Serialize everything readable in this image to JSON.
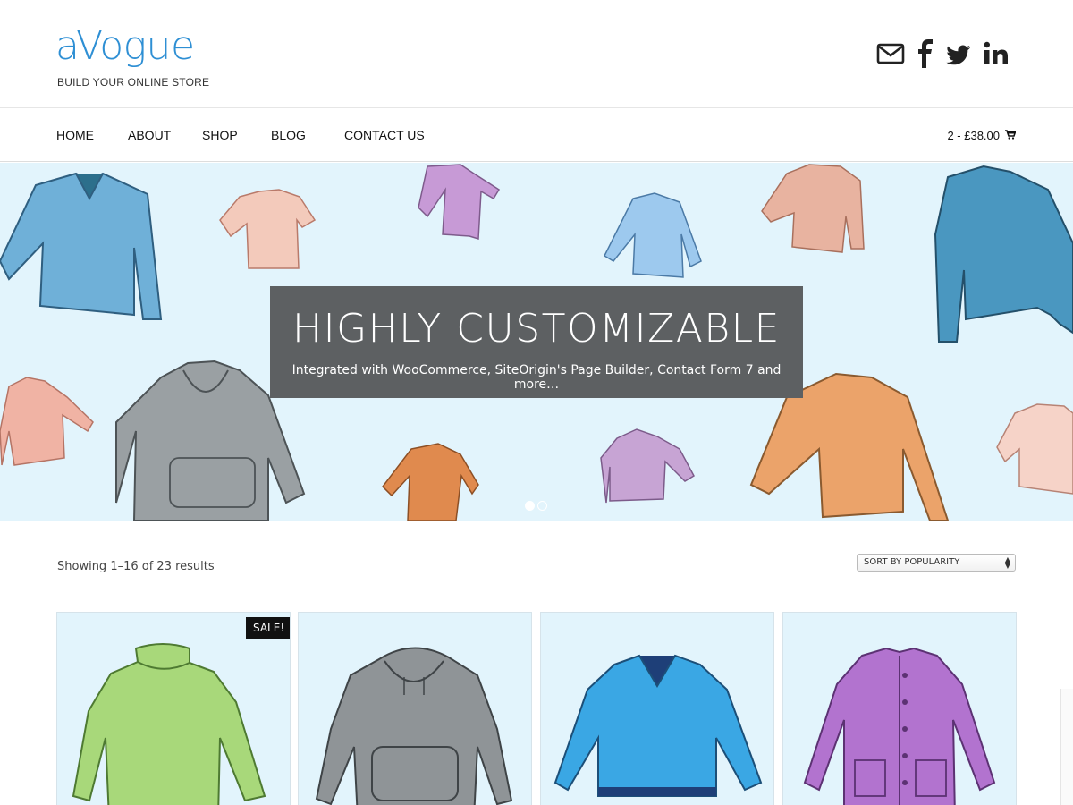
{
  "site": {
    "logo": "aVogue",
    "tagline": "BUILD YOUR ONLINE STORE"
  },
  "social": [
    "mail-icon",
    "facebook-icon",
    "twitter-icon",
    "linkedin-icon"
  ],
  "nav": {
    "items": [
      "HOME",
      "ABOUT",
      "SHOP",
      "BLOG",
      "CONTACT US"
    ],
    "cart": "2 - £38.00"
  },
  "hero": {
    "title": "HIGHLY CUSTOMIZABLE",
    "subtitle": "Integrated with WooCommerce, SiteOrigin's Page Builder, Contact Form 7 and more…",
    "slides": 2,
    "active_slide": 1
  },
  "shop": {
    "results_text": "Showing 1–16 of 23 results",
    "sort_selected": "SORT BY POPULARITY"
  },
  "products": [
    {
      "illustration": "green-turtleneck",
      "sale_badge": "SALE!"
    },
    {
      "illustration": "grey-hoodie",
      "sale_badge": ""
    },
    {
      "illustration": "blue-vneck-sweater",
      "sale_badge": ""
    },
    {
      "illustration": "purple-cardigan",
      "sale_badge": ""
    }
  ],
  "colors": {
    "brand": "#2e8fd4",
    "hero_bg": "#e2f4fc",
    "hero_box": "#5d6062",
    "sale_badge_bg": "#111111"
  }
}
